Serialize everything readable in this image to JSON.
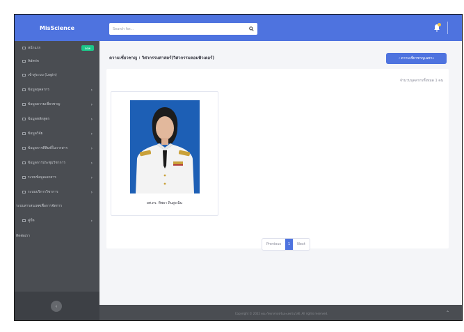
{
  "brand": "MisScience",
  "search": {
    "placeholder": "Search for..."
  },
  "sidebar": {
    "items": [
      {
        "label": "หน้าแรก",
        "badge": "new"
      },
      {
        "label": "Admin"
      },
      {
        "label": "เข้าสู่ระบบ (Login)"
      },
      {
        "label": "ข้อมูลบุคลากร"
      },
      {
        "label": "ข้อมูลความเชี่ยวชาญ"
      },
      {
        "label": "ข้อมูลหลักสูตร"
      },
      {
        "label": "ข้อมูลวิจัย"
      },
      {
        "label": "ข้อมูลการตีพิมพ์ในวารสาร"
      },
      {
        "label": "ข้อมูลการประชุมวิชาการ"
      },
      {
        "label": "ระบบข้อมูลเอกสาร"
      },
      {
        "label": "ระบบบริการวิชาการ"
      },
      {
        "label": "ระบบสารสนเทศเพื่อการจัดการ"
      },
      {
        "label": "คู่มือ"
      },
      {
        "label": "ติดต่อเรา"
      }
    ]
  },
  "page": {
    "heading": "ความเชี่ยวชาญ : วิศวกรรมศาสตร์(วิศวกรรมคอมพิวเตอร์)",
    "back_button": "‹ ความเชี่ยวชาญเฉพาะ",
    "count_text": "จำนวนบุคลากรทั้งหมด 1 คน"
  },
  "person": {
    "name": "ผศ.ดร. ทิพยา ถินสูงเนิน"
  },
  "pagination": {
    "previous": "Previous",
    "current": "1",
    "next": "Next"
  },
  "footer": {
    "text": "Copyright © 2022 คณะวิทยาศาสตร์และเทคโนโลยี. All rights reserved."
  },
  "colors": {
    "primary": "#4e73df",
    "sidebar": "#4a4d52",
    "badge": "#1cc88a"
  }
}
